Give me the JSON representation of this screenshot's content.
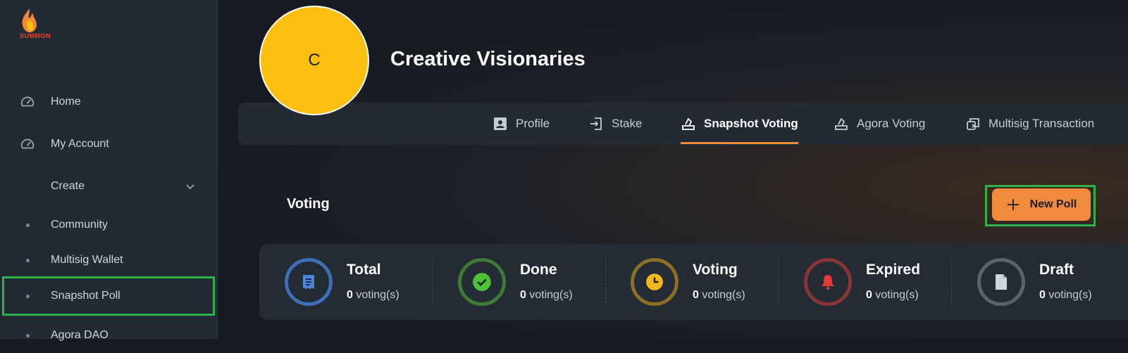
{
  "app": {
    "logo_text": "SUMMON"
  },
  "sidebar": {
    "items": [
      {
        "label": "Home",
        "icon": "dashboard-icon"
      },
      {
        "label": "My Account",
        "icon": "dashboard-icon"
      },
      {
        "label": "Create",
        "icon": "chevron-down-icon"
      },
      {
        "label": "Community"
      },
      {
        "label": "Multisig Wallet"
      },
      {
        "label": "Snapshot Poll"
      },
      {
        "label": "Agora DAO"
      }
    ]
  },
  "community": {
    "avatar_letter": "C",
    "name": "Creative Visionaries"
  },
  "tabs": [
    {
      "label": "Profile",
      "icon": "profile-card-icon"
    },
    {
      "label": "Stake",
      "icon": "login-icon"
    },
    {
      "label": "Snapshot Voting",
      "icon": "ballot-icon",
      "active": true
    },
    {
      "label": "Agora Voting",
      "icon": "ballot-icon"
    },
    {
      "label": "Multisig Transaction",
      "icon": "transfer-icon"
    }
  ],
  "voting": {
    "title": "Voting",
    "new_poll_label": "New Poll",
    "stats": [
      {
        "label": "Total",
        "count": "0",
        "unit": "voting(s)",
        "icon": "receipt-icon",
        "color": "#3d6fb8"
      },
      {
        "label": "Done",
        "count": "0",
        "unit": "voting(s)",
        "icon": "check-circle-icon",
        "color": "#3fae3a"
      },
      {
        "label": "Voting",
        "count": "0",
        "unit": "voting(s)",
        "icon": "clock-icon",
        "color": "#e3b019"
      },
      {
        "label": "Expired",
        "count": "0",
        "unit": "voting(s)",
        "icon": "bell-icon",
        "color": "#e23b3b"
      },
      {
        "label": "Draft",
        "count": "0",
        "unit": "voting(s)",
        "icon": "document-icon",
        "color": "#9aa1aa"
      }
    ]
  },
  "colors": {
    "accent": "#f08a3c",
    "highlight": "#2fb24a",
    "avatar": "#fcbf10"
  }
}
